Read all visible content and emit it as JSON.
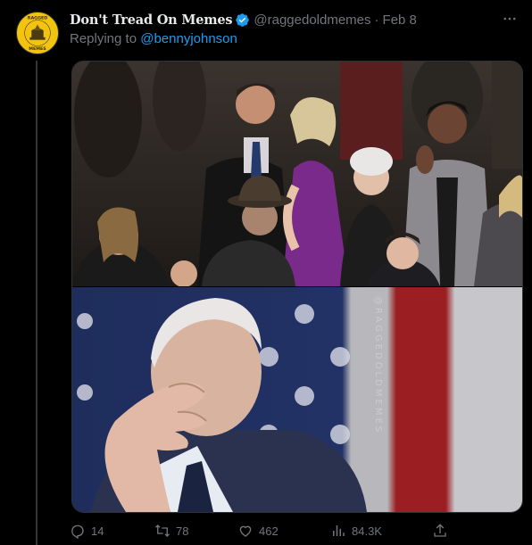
{
  "tweet": {
    "display_name": "Don't Tread On Memes",
    "handle": "@raggedoldmemes",
    "separator": "·",
    "date": "Feb 8",
    "reply_prefix": "Replying to",
    "reply_to": "@bennyjohnson",
    "avatar_text": "RAGGEDOLDMEMES"
  },
  "media": {
    "watermark": "@RAGGEDOLDMEMES"
  },
  "actions": {
    "replies": "14",
    "retweets": "78",
    "likes": "462",
    "views": "84.3K"
  },
  "icons": {
    "verified": "verified-badge-icon",
    "more": "more-icon",
    "reply": "reply-icon",
    "retweet": "retweet-icon",
    "like": "heart-icon",
    "views": "views-icon",
    "share": "share-icon"
  },
  "colors": {
    "background": "#000000",
    "text": "#e7e9ea",
    "muted": "#71767b",
    "accent": "#1d9bf0",
    "avatar_bg": "#f2c40f"
  }
}
